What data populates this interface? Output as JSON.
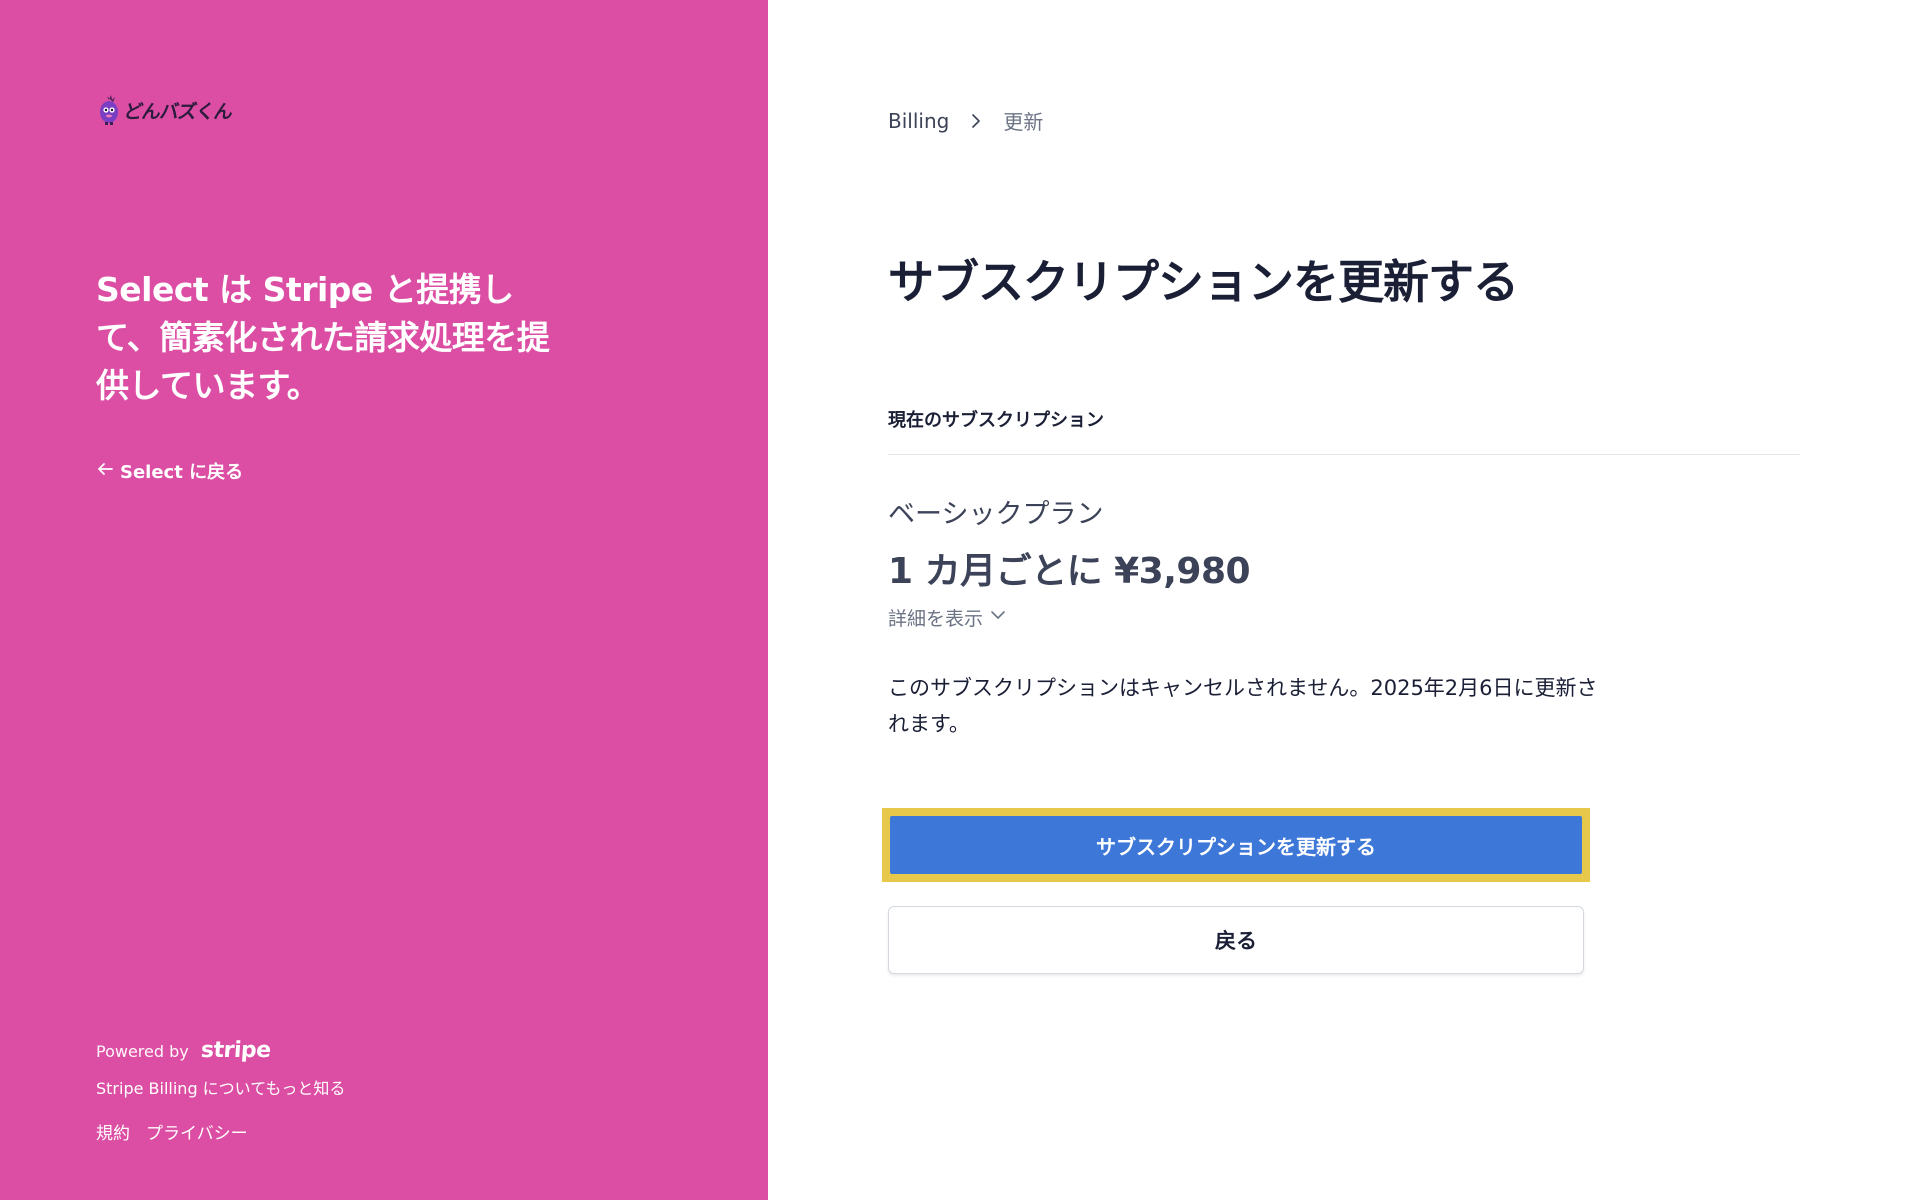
{
  "brand": {
    "logo_text": "どんバズくん",
    "tagline": "Select は Stripe と提携して、簡素化された請求処理を提供しています。",
    "back_link": "Select に戻る",
    "powered_by": "Powered by",
    "stripe_wordmark": "stripe",
    "learn_more": "Stripe Billing についてもっと知る",
    "terms": "規約",
    "privacy": "プライバシー",
    "panel_color": "#dc4ea3"
  },
  "breadcrumb": {
    "billing": "Billing",
    "current": "更新"
  },
  "main": {
    "title": "サブスクリプションを更新する",
    "section_label": "現在のサブスクリプション",
    "plan_name": "ベーシックプラン",
    "plan_price": "1 カ月ごとに ¥3,980",
    "details_toggle": "詳細を表示",
    "renew_note": "このサブスクリプションはキャンセルされません。2025年2月6日に更新されます。",
    "primary_button": "サブスクリプションを更新する",
    "secondary_button": "戻る",
    "accent_color": "#3d77d8",
    "highlight_color": "#e8c84a"
  }
}
